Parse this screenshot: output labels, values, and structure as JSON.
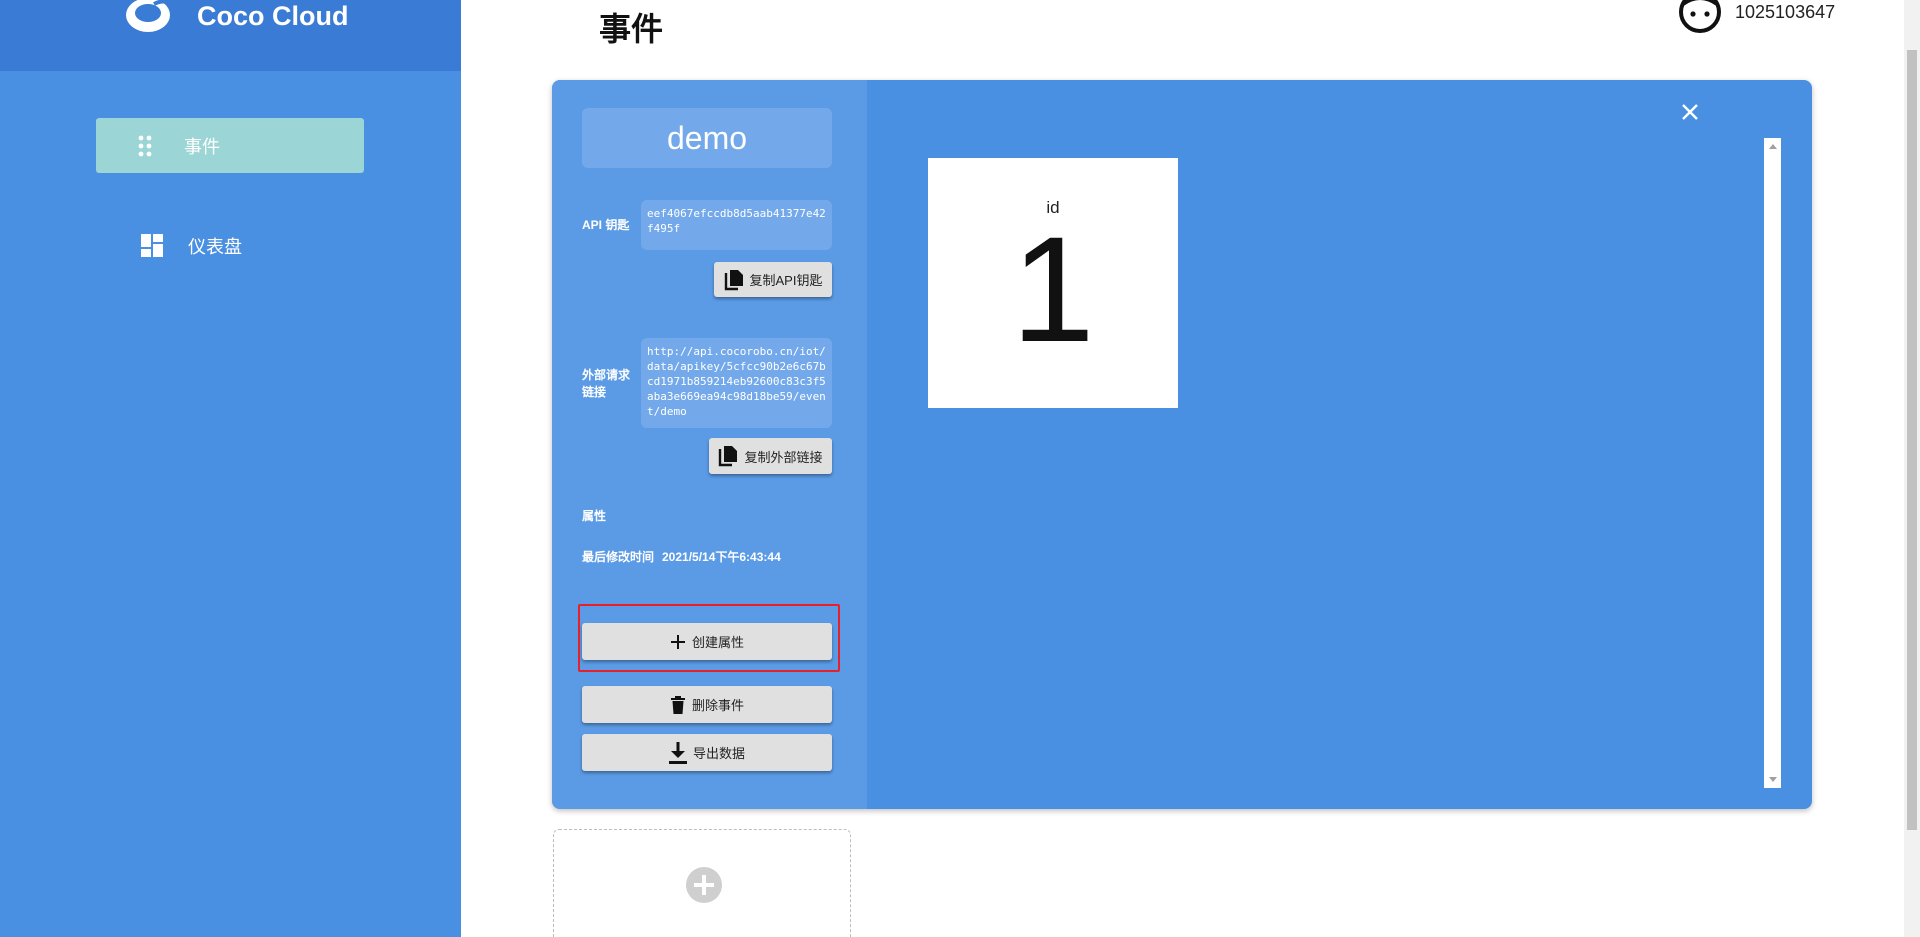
{
  "brand": {
    "name": "Coco Cloud",
    "logo_icon": "coco-logo-icon"
  },
  "sidebar": {
    "items": [
      {
        "label": "事件",
        "icon": "grid-dots-icon",
        "active": true
      },
      {
        "label": "仪表盘",
        "icon": "dashboard-icon",
        "active": false
      }
    ]
  },
  "header": {
    "title": "事件",
    "user_id": "1025103647",
    "avatar_icon": "face-icon"
  },
  "event_card": {
    "name": "demo",
    "api_key_label": "API 钥匙",
    "api_key_value": "eef4067efccdb8d5aab41377e42f495f",
    "copy_api_key_label": "复制API钥匙",
    "external_url_label": "外部请求链接",
    "external_url_value": "http://api.cocorobo.cn/iot/data/apikey/5cfcc90b2e6c67bcd1971b859214eb92600c83c3f5aba3e669ea94c98d18be59/event/demo",
    "copy_external_url_label": "复制外部链接",
    "attributes_label": "属性",
    "last_modified_label": "最后修改时间",
    "last_modified_value": "2021/5/14下午6:43:44",
    "create_attribute_label": "创建属性",
    "delete_event_label": "删除事件",
    "export_data_label": "导出数据",
    "attributes": [
      {
        "name": "id",
        "value": "1"
      }
    ]
  },
  "colors": {
    "sidebar_bg": "#4a90e2",
    "sidebar_header_bg": "#3a7bd5",
    "active_nav_bg": "#9bd5d6",
    "card_bg": "#4a90e2",
    "card_left_bg": "#5b9be6",
    "highlight": "#e8202a"
  }
}
